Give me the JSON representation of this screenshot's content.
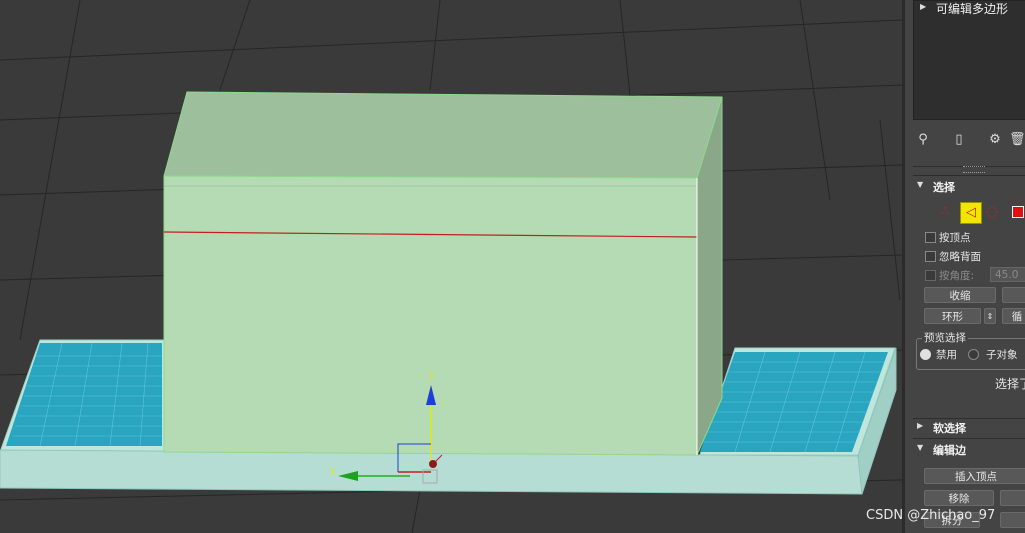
{
  "modifier_stack": {
    "items": [
      {
        "label": "可编辑多边形"
      }
    ]
  },
  "toolbar": {
    "icons": [
      "pin-icon",
      "show-end-result-icon",
      "make-unique-icon",
      "remove-modifier-icon"
    ]
  },
  "selection": {
    "title": "选择",
    "by_vertex": "按顶点",
    "ignore_backfacing": "忽略背面",
    "by_angle": "按角度:",
    "angle_value": "45.0",
    "shrink": "收缩",
    "ring": "环形",
    "preview_selection": "预览选择",
    "disabled": "禁用",
    "sub_object": "子对象",
    "selected_text": "选择了"
  },
  "soft_selection": {
    "title": "软选择"
  },
  "edit_edges": {
    "title": "编辑边",
    "insert_vertex": "插入顶点",
    "remove": "移除",
    "split": "拆分"
  },
  "gizmo": {
    "z_label": "z",
    "y_label": "y"
  },
  "watermark": "CSDN @Zhichao_97",
  "colors": {
    "viewport_bg": "#3a3a3a",
    "box_front": "#b5dbb4",
    "box_top": "#9cbf9a",
    "box_side": "#89a888",
    "base_slab": "#b7e2d9",
    "glass_tile": "#2aa5c0",
    "selected_edge": "#c21f1f",
    "panel_bg": "#444444",
    "highlight_yellow": "#f2e600"
  }
}
